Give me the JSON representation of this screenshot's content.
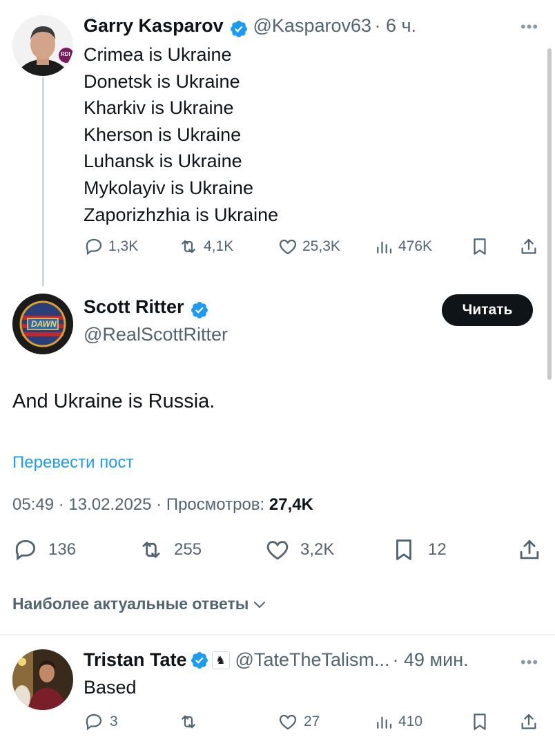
{
  "tweet1": {
    "name": "Garry Kasparov",
    "handle": "@Kasparov63",
    "time": "· 6 ч.",
    "lines": [
      "Crimea is Ukraine",
      "Donetsk is Ukraine",
      "Kharkiv is Ukraine",
      "Kherson is Ukraine",
      "Luhansk is Ukraine",
      "Mykolayiv is Ukraine",
      "Zaporizhzhia is Ukraine"
    ],
    "replies": "1,3K",
    "reposts": "4,1K",
    "likes": "25,3K",
    "views": "476K",
    "avatar_badge": "RDI"
  },
  "tweet2": {
    "name": "Scott Ritter",
    "handle": "@RealScottRitter",
    "follow_label": "Читать",
    "text": "And Ukraine is Russia.",
    "translate_label": "Перевести пост",
    "timestamp": "05:49 · 13.02.2025 · Просмотров: ",
    "views_count": "27,4K",
    "replies": "136",
    "reposts": "255",
    "likes": "3,2K",
    "bookmarks": "12",
    "avatar_text": "DAWN"
  },
  "sort_label": "Наиболее актуальные ответы",
  "reply1": {
    "name": "Tristan Tate",
    "handle": "@TateTheTalism...",
    "time": "· 49 мин.",
    "text": "Based",
    "replies": "3",
    "likes": "27",
    "views": "410"
  },
  "colors": {
    "text": "#0f1419",
    "secondary": "#536471",
    "link": "#1d9bf0",
    "verified": "#1d9bf0",
    "divider": "#eff3f4"
  }
}
